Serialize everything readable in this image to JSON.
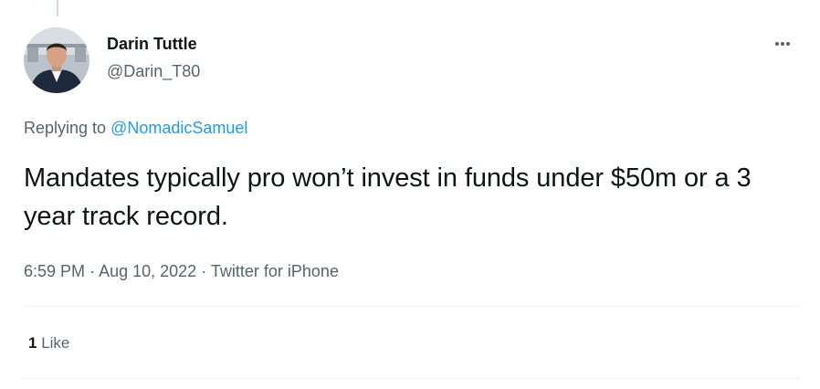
{
  "tweet": {
    "author": {
      "display_name": "Darin Tuttle",
      "handle": "@Darin_T80"
    },
    "replying_prefix": "Replying to ",
    "replying_to": "@NomadicSamuel",
    "text": "Mandates typically pro won’t invest in funds under $50m or a 3 year track record.",
    "time": "6:59 PM",
    "separator": "·",
    "date": "Aug 10, 2022",
    "source": "Twitter for iPhone",
    "likes_count": "1",
    "likes_label": "Like"
  },
  "icons": {
    "more": "more-horizontal-icon"
  },
  "colors": {
    "link": "#1d9bf0",
    "secondary_text": "#536471",
    "primary_text": "#0f1419",
    "divider": "#eff3f4"
  }
}
